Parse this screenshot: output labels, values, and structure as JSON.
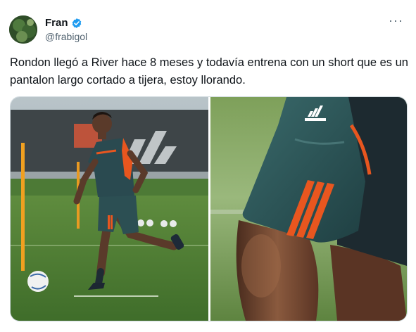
{
  "author": {
    "name": "Fran",
    "handle": "@frabigol",
    "verified": true,
    "verified_color": "#1d9bf0"
  },
  "menu": {
    "more_label": "···"
  },
  "tweet": {
    "text": "Rondon llegó a River hace 8 meses y todavía entrena con un short que es un pantalon largo cortado a tijera, estoy llorando."
  },
  "media": {
    "images": [
      {
        "name": "player-training-photo",
        "brand_logo": "adidas"
      },
      {
        "name": "shorts-closeup-photo",
        "brand_logo": "adidas"
      }
    ]
  },
  "colors": {
    "text": "#0f1419",
    "secondary": "#536471",
    "border": "#cfd9de",
    "accent_orange": "#e8561f",
    "kit_teal": "#2c5455"
  }
}
